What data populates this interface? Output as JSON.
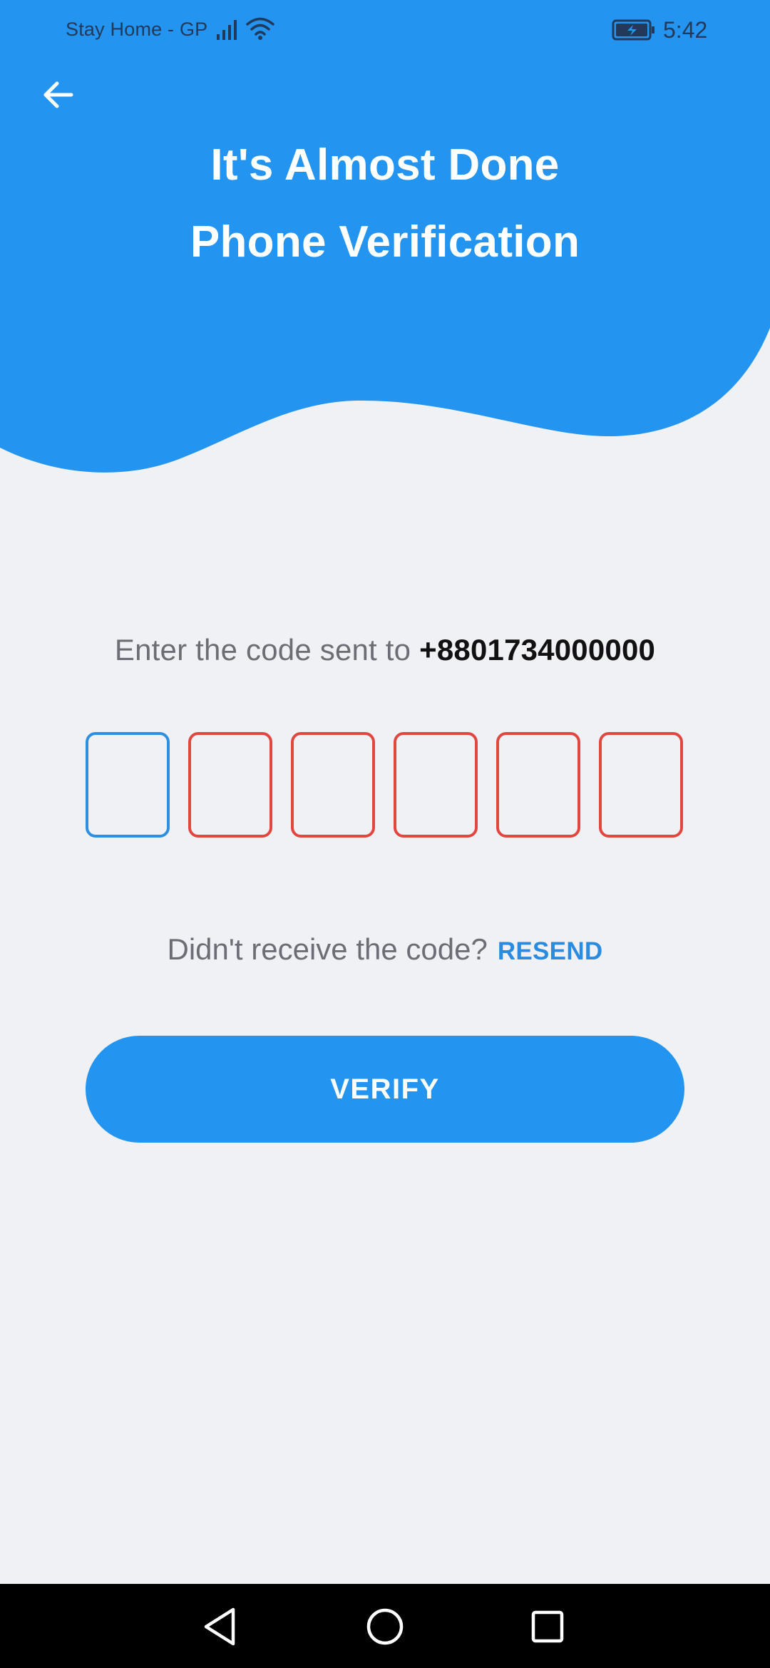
{
  "status_bar": {
    "carrier": "Stay Home - GP",
    "time": "5:42",
    "icons": [
      "signal-icon",
      "wifi-icon",
      "battery-charging-icon"
    ]
  },
  "header": {
    "back_icon": "arrow-left-icon",
    "title_line_1": "It's Almost Done",
    "title_line_2": "Phone Verification"
  },
  "verification": {
    "instruction_prefix": "Enter the code sent to ",
    "phone_number": "+8801734000000",
    "otp_digits": [
      "",
      "",
      "",
      "",
      "",
      ""
    ]
  },
  "resend": {
    "prompt": "Didn't receive the code?",
    "link_label": "RESEND"
  },
  "verify_button": {
    "label": "VERIFY"
  },
  "navigation": {
    "icons": [
      "nav-back-icon",
      "nav-home-icon",
      "nav-recents-icon"
    ]
  },
  "colors": {
    "primary": "#2394F0",
    "background": "#F0F1F5",
    "error_border": "#E0473F",
    "active_border": "#2E8FE0",
    "link": "#2A8BE0"
  }
}
